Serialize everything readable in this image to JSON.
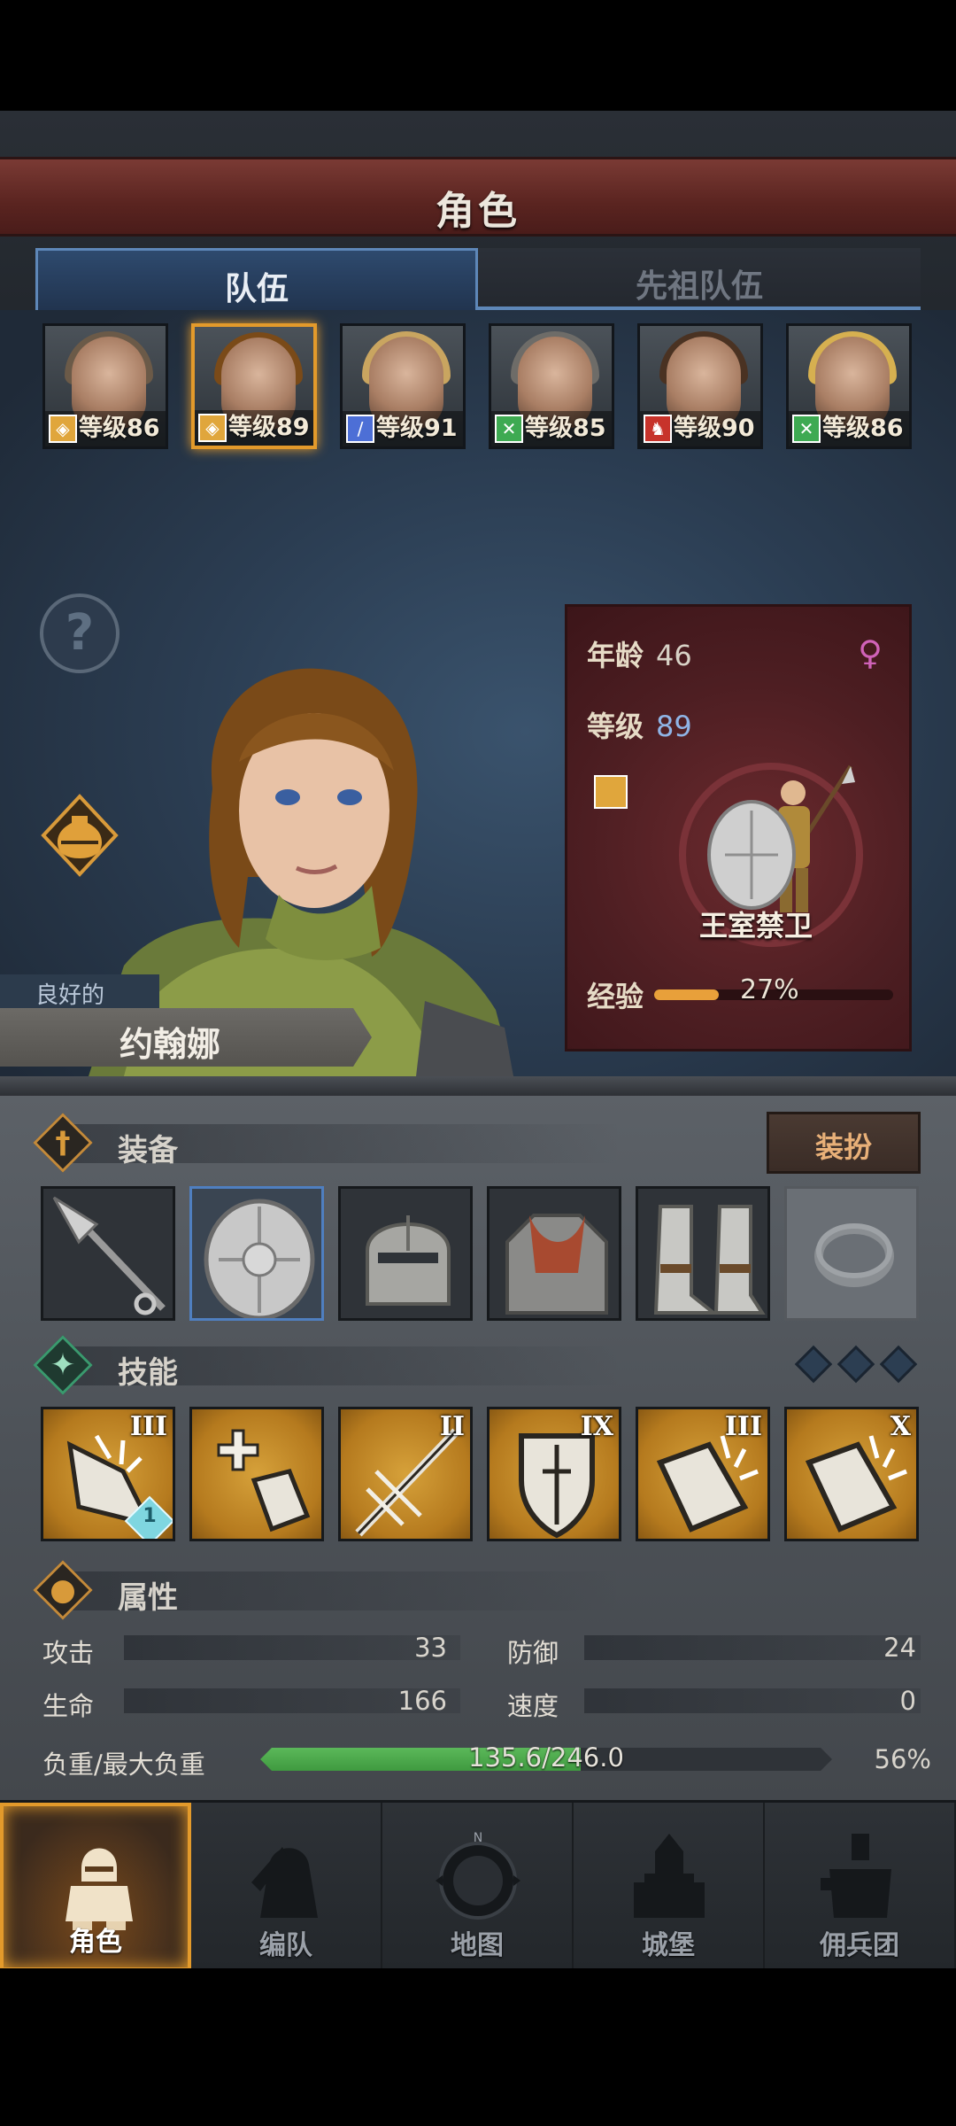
{
  "header": {
    "title": "角色"
  },
  "tabs": [
    {
      "label": "队伍",
      "active": true
    },
    {
      "label": "先祖队伍",
      "active": false
    }
  ],
  "roster": [
    {
      "level_text": "等级86",
      "class_icon": "shield-icon",
      "badge_color": "#e0a63c",
      "hair": "#6b5a48",
      "selected": false
    },
    {
      "level_text": "等级89",
      "class_icon": "shield-icon",
      "badge_color": "#e0a63c",
      "hair": "#7a4a18",
      "selected": true
    },
    {
      "level_text": "等级91",
      "class_icon": "sword-icon",
      "badge_color": "#4d6fd6",
      "hair": "#c9a560",
      "selected": false
    },
    {
      "level_text": "等级85",
      "class_icon": "cross-icon",
      "badge_color": "#3eaa52",
      "hair": "#6e6c68",
      "selected": false
    },
    {
      "level_text": "等级90",
      "class_icon": "horse-icon",
      "badge_color": "#c7332b",
      "hair": "#4a3222",
      "selected": false
    },
    {
      "level_text": "等级86",
      "class_icon": "cross-icon",
      "badge_color": "#3eaa52",
      "hair": "#d6b050",
      "selected": false
    }
  ],
  "character": {
    "condition": "良好的",
    "name": "约翰娜",
    "age_label": "年龄",
    "age": "46",
    "level_label": "等级",
    "level": "89",
    "gender_icon": "female-icon",
    "class_name": "王室禁卫",
    "exp_label": "经验",
    "exp_percent_text": "27%",
    "exp_fraction": 0.27
  },
  "equipment": {
    "label": "装备",
    "dress_button": "装扮",
    "slots": [
      "spear-icon",
      "shield-icon",
      "helmet-icon",
      "armor-icon",
      "boots-icon",
      "ring-icon"
    ]
  },
  "skills": {
    "label": "技能",
    "items": [
      {
        "icon": "shield-break-icon",
        "tier": "III",
        "gem": "1"
      },
      {
        "icon": "heal-shield-icon",
        "tier": "",
        "gem": ""
      },
      {
        "icon": "spear-thrust-icon",
        "tier": "II",
        "gem": ""
      },
      {
        "icon": "shield-guard-icon",
        "tier": "IX",
        "gem": ""
      },
      {
        "icon": "shield-bash-icon",
        "tier": "III",
        "gem": ""
      },
      {
        "icon": "shield-bash-icon",
        "tier": "X",
        "gem": ""
      }
    ]
  },
  "attributes": {
    "label": "属性",
    "attack_label": "攻击",
    "attack": "33",
    "defense_label": "防御",
    "defense": "24",
    "hp_label": "生命",
    "hp": "166",
    "speed_label": "速度",
    "speed": "0",
    "load_label": "负重/最大负重",
    "load_text": "135.6/246.0",
    "load_percent": "56%",
    "load_fraction": 0.56
  },
  "nav": [
    {
      "label": "角色",
      "icon": "knight-icon",
      "active": true
    },
    {
      "label": "编队",
      "icon": "formation-icon",
      "active": false
    },
    {
      "label": "地图",
      "icon": "compass-map-icon",
      "active": false
    },
    {
      "label": "城堡",
      "icon": "castle-icon",
      "active": false
    },
    {
      "label": "佣兵团",
      "icon": "mercenary-icon",
      "active": false
    }
  ],
  "colors": {
    "accent": "#e39a2b",
    "tab_blue": "#5e87b8",
    "skill_gold": "#d6a13a",
    "load_green": "#4fae4e"
  }
}
